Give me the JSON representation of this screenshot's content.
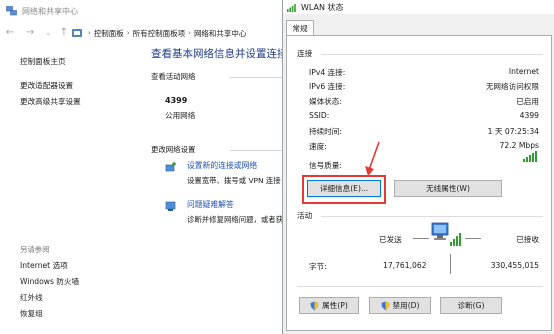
{
  "nsc": {
    "title": "网络和共享中心",
    "breadcrumb": [
      "控制面板",
      "所有控制面板项",
      "网络和共享中心"
    ],
    "left_links": [
      "控制面板主页",
      "更改适配器设置",
      "更改高级共享设置"
    ],
    "see_also_label": "另请参阅",
    "see_also_links": [
      "Internet 选项",
      "Windows 防火墙",
      "红外线",
      "恢复组"
    ],
    "heading": "查看基本网络信息并设置连接",
    "active_networks_label": "查看活动网络",
    "network_name": "4399",
    "network_type": "公用网络",
    "change_settings_label": "更改网络设置",
    "tasks": [
      {
        "link": "设置新的连接或网络",
        "desc": "设置宽带、拨号或 VPN 连接；或设置路由器或接入点。"
      },
      {
        "link": "问题疑难解答",
        "desc": "诊断并修复网络问题，或者获得故障排除信息。"
      }
    ]
  },
  "dialog": {
    "title": "WLAN 状态",
    "tab_general": "常规",
    "connection_label": "连接",
    "fields": [
      {
        "key": "IPv4 连接:",
        "value": "Internet"
      },
      {
        "key": "IPv6 连接:",
        "value": "无网络访问权限"
      },
      {
        "key": "媒体状态:",
        "value": "已启用"
      },
      {
        "key": "SSID:",
        "value": "4399"
      },
      {
        "key": "持续时间:",
        "value": "1 天 07:25:34"
      },
      {
        "key": "速度:",
        "value": "72.2 Mbps"
      }
    ],
    "signal_label": "信号质量:",
    "signal_bars": 5,
    "details_button": "详细信息(E)...",
    "wireless_props_button": "无线属性(W)",
    "activity_label": "活动",
    "sent_label": "已发送",
    "received_label": "已接收",
    "bytes_label": "字节:",
    "bytes_sent": "17,761,062",
    "bytes_received": "330,455,015",
    "properties_button": "属性(P)",
    "disable_button": "禁用(D)",
    "diagnose_button": "诊断(G)"
  },
  "colors": {
    "accent_link": "#1e4fb0",
    "heading": "#1e3a8a",
    "highlight": "#e53935",
    "signal": "#2e9e2e"
  },
  "icons": [
    "network-center-icon",
    "back-arrow-icon",
    "forward-arrow-icon",
    "up-arrow-icon",
    "control-panel-icon",
    "wifi-signal-icon",
    "new-connection-icon",
    "troubleshoot-icon",
    "computer-network-icon",
    "uac-shield-icon"
  ]
}
